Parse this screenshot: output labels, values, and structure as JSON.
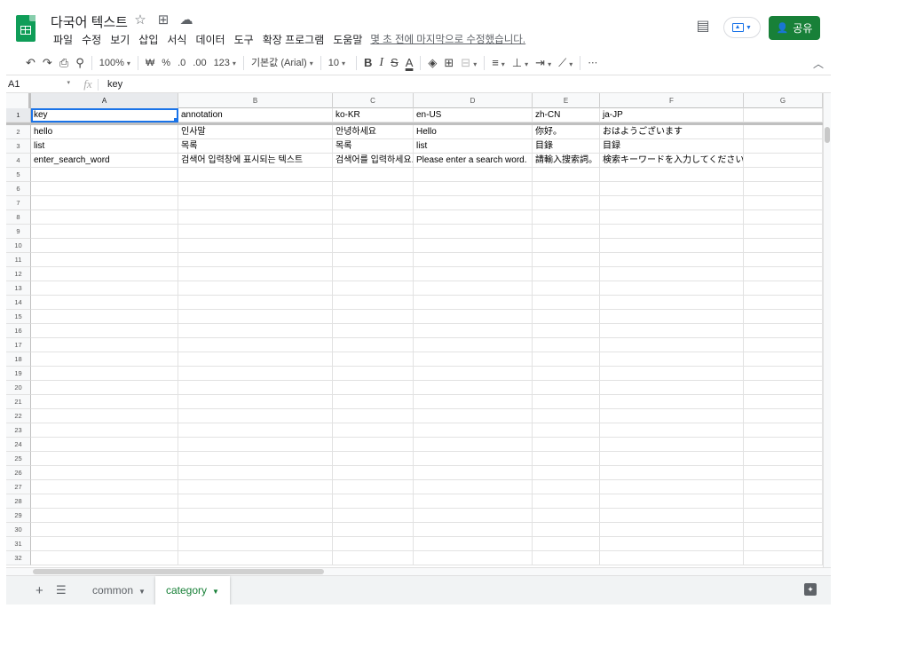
{
  "header": {
    "title": "다국어 텍스트",
    "icons": [
      "star-icon",
      "move-to-folder-icon",
      "cloud-status-icon"
    ],
    "menu": [
      "파일",
      "수정",
      "보기",
      "삽입",
      "서식",
      "데이터",
      "도구",
      "확장 프로그램",
      "도움말"
    ],
    "last_edit": "몇 초 전에 마지막으로 수정했습니다.",
    "share_label": "공유"
  },
  "toolbar": {
    "zoom": "100%",
    "currency": "₩",
    "percent": "%",
    "dec_decrease": ".0",
    "dec_increase": ".00",
    "more_formats": "123",
    "font": "기본값 (Arial)",
    "font_size": "10",
    "bold": "B",
    "italic": "I",
    "strike": "S",
    "text_color": "A"
  },
  "formula_bar": {
    "cell_ref": "A1",
    "fx": "fx",
    "value": "key"
  },
  "grid": {
    "columns": [
      "A",
      "B",
      "C",
      "D",
      "E",
      "F",
      "G"
    ],
    "row_numbers": [
      "1",
      "2",
      "3",
      "4",
      "5",
      "6",
      "7",
      "8",
      "9",
      "10",
      "11",
      "12",
      "13",
      "14",
      "15",
      "16",
      "17",
      "18",
      "19",
      "20",
      "21",
      "22",
      "23",
      "24",
      "25",
      "26",
      "27",
      "28",
      "29",
      "30",
      "31",
      "32"
    ],
    "rows": [
      [
        "key",
        "annotation",
        "ko-KR",
        "en-US",
        "zh-CN",
        "ja-JP",
        ""
      ],
      [
        "hello",
        "인사말",
        "안녕하세요",
        "Hello",
        "你好。",
        "おはようございます",
        ""
      ],
      [
        "list",
        "목록",
        "목록",
        "list",
        "目錄",
        "目録",
        ""
      ],
      [
        "enter_search_word",
        "검색어 입력창에 표시되는 텍스트",
        "검색어를 입력하세요.",
        "Please enter a search word.",
        "請輸入搜索詞。",
        "検索キーワードを入力してください。",
        ""
      ]
    ]
  },
  "sheets": {
    "tabs": [
      "common",
      "category"
    ],
    "active": "category"
  },
  "colors": {
    "brand_green": "#188038",
    "selection_blue": "#1a73e8"
  }
}
